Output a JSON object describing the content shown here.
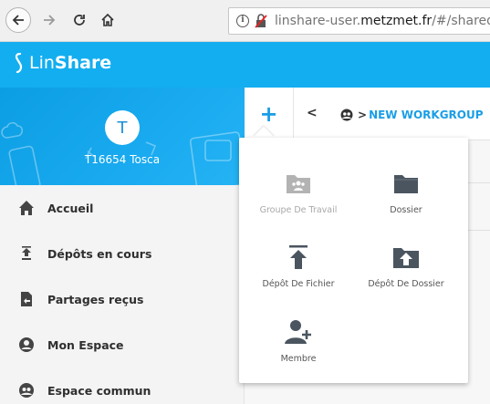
{
  "browser": {
    "url_prefix": "linshare-user.",
    "url_host": "metzmet.fr",
    "url_suffix": "/#/sharedsp"
  },
  "app": {
    "logo_lin": "Lin",
    "logo_share": "Share"
  },
  "profile": {
    "avatar_initial": "T",
    "username": "T16654 Tosca"
  },
  "sidebar": {
    "items": [
      {
        "label": "Accueil",
        "icon": "home-icon"
      },
      {
        "label": "Dépôts en cours",
        "icon": "upload-queue-icon"
      },
      {
        "label": "Partages reçus",
        "icon": "received-shares-icon"
      },
      {
        "label": "Mon Espace",
        "icon": "personal-space-icon"
      },
      {
        "label": "Espace commun",
        "icon": "shared-space-icon"
      }
    ]
  },
  "toolbar": {
    "plus_label": "+",
    "back_label": "<",
    "crumb_arrow": ">",
    "workgroup": "NEW WORKGROUP"
  },
  "popup": {
    "items": [
      {
        "label": "Groupe De Travail",
        "icon": "workgroup-folder-icon",
        "disabled": true
      },
      {
        "label": "Dossier",
        "icon": "folder-icon",
        "disabled": false
      },
      {
        "label": "Dépôt De Fichier",
        "icon": "upload-file-icon",
        "disabled": false
      },
      {
        "label": "Dépôt De Dossier",
        "icon": "upload-folder-icon",
        "disabled": false
      },
      {
        "label": "Membre",
        "icon": "add-member-icon",
        "disabled": false
      }
    ]
  },
  "colors": {
    "brand": "#13aef0",
    "accent": "#1a9ee6",
    "icon_dark": "#4a5560",
    "icon_disabled": "#b3b3b3"
  }
}
